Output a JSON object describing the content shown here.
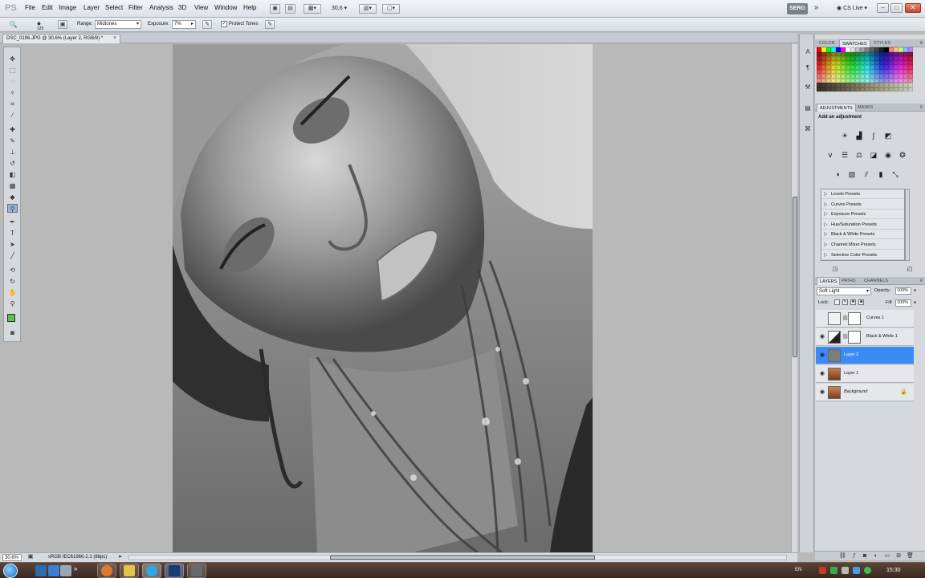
{
  "app": {
    "logo": "PS"
  },
  "menu": [
    "File",
    "Edit",
    "Image",
    "Layer",
    "Select",
    "Filter",
    "Analysis",
    "3D",
    "View",
    "Window",
    "Help"
  ],
  "toolbar": {
    "zoom": "30,6",
    "workspace": "SERG",
    "more": "»",
    "cslive": "CS Live"
  },
  "window_controls": {
    "minimize": "–",
    "maximize": "□",
    "close": "✕"
  },
  "options": {
    "brush_size": "125",
    "range_label": "Range:",
    "range_value": "Midtones",
    "exposure_label": "Exposure:",
    "exposure_value": "7%",
    "protect_check": "✓",
    "protect_label": "Protect Tones"
  },
  "document": {
    "tab_title": "DSC_0196.JPG @ 30,6% (Layer 2, RGB/8) *",
    "tab_close": "×"
  },
  "status": {
    "zoom": "30,6%",
    "profile": "sRGB IEC61966-2.1 (8bpc)"
  },
  "panels": {
    "color_tabs": [
      "COLOR",
      "SWATCHES",
      "STYLES"
    ],
    "adjust_tabs": [
      "ADJUSTMENTS",
      "MASKS"
    ],
    "adjust_title": "Add an adjustment",
    "presets": [
      "Levels Presets",
      "Curves Presets",
      "Exposure Presets",
      "Hue/Saturation Presets",
      "Black & White Presets",
      "Channel Mixer Presets",
      "Selective Color Presets"
    ],
    "layer_tabs": [
      "LAYERS",
      "PATHS",
      "CHANNELS"
    ],
    "blend_mode": "Soft Light",
    "opacity_label": "Opacity:",
    "opacity_value": "100%",
    "lock_label": "Lock:",
    "fill_label": "Fill:",
    "fill_value": "100%",
    "layers": [
      {
        "name": "Curves 1",
        "visible": false,
        "selected": false
      },
      {
        "name": "Black & White 1",
        "visible": true,
        "selected": false
      },
      {
        "name": "Layer 2",
        "visible": true,
        "selected": true
      },
      {
        "name": "Layer 1",
        "visible": true,
        "selected": false
      },
      {
        "name": "Background",
        "visible": true,
        "selected": false,
        "locked": true
      }
    ]
  },
  "taskbar": {
    "lang": "EN",
    "clock": "15:30"
  },
  "colors": {
    "accent": "#3b8bf6",
    "foreground": "#60c04a",
    "workspace_bg": "#b9b9b9"
  }
}
